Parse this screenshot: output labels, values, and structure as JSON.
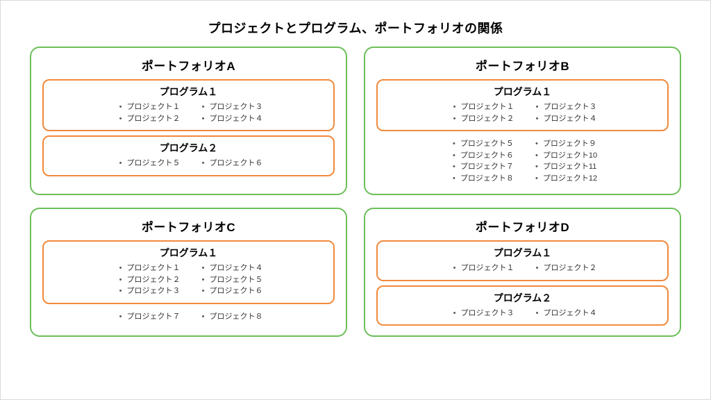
{
  "title": "プロジェクトとプログラム、ポートフォリオの関係",
  "portfolios": [
    {
      "title": "ポートフォリオA",
      "programs": [
        {
          "title": "プログラム１",
          "cols": [
            [
              "プロジェクト１",
              "プロジェクト２"
            ],
            [
              "プロジェクト３",
              "プロジェクト４"
            ]
          ]
        },
        {
          "title": "プログラム２",
          "cols": [
            [
              "プロジェクト５"
            ],
            [
              "プロジェクト６"
            ]
          ]
        }
      ],
      "loose": []
    },
    {
      "title": "ポートフォリオB",
      "programs": [
        {
          "title": "プログラム１",
          "cols": [
            [
              "プロジェクト１",
              "プロジェクト２"
            ],
            [
              "プロジェクト３",
              "プロジェクト４"
            ]
          ]
        }
      ],
      "loose": [
        [
          "プロジェクト５",
          "プロジェクト６",
          "プロジェクト７",
          "プロジェクト８"
        ],
        [
          "プロジェクト９",
          "プロジェクト10",
          "プロジェクト11",
          "プロジェクト12"
        ]
      ]
    },
    {
      "title": "ポートフォリオC",
      "programs": [
        {
          "title": "プログラム１",
          "cols": [
            [
              "プロジェクト１",
              "プロジェクト２",
              "プロジェクト３"
            ],
            [
              "プロジェクト４",
              "プロジェクト５",
              "プロジェクト６"
            ]
          ]
        }
      ],
      "loose": [
        [
          "プロジェクト７"
        ],
        [
          "プロジェクト８"
        ]
      ]
    },
    {
      "title": "ポートフォリオD",
      "programs": [
        {
          "title": "プログラム１",
          "cols": [
            [
              "プロジェクト１"
            ],
            [
              "プロジェクト２"
            ]
          ]
        },
        {
          "title": "プログラム２",
          "cols": [
            [
              "プロジェクト３"
            ],
            [
              "プロジェクト４"
            ]
          ]
        }
      ],
      "loose": []
    }
  ]
}
